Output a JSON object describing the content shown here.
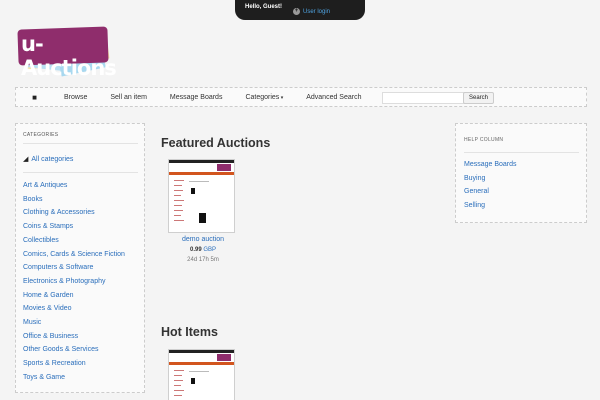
{
  "topbar": {
    "greeting": "Hello, Guest!",
    "login_label": "User login",
    "login_icon": "plus-circle-icon"
  },
  "logo": {
    "text": "u-Auctions",
    "brand_color": "#8f2d6c"
  },
  "nav": {
    "home_icon": "home-icon",
    "items": [
      "Browse",
      "Sell an item",
      "Message Boards",
      "Categories",
      "Advanced Search"
    ],
    "search_value": "",
    "search_button": "Search"
  },
  "categories": {
    "heading": "CATEGORIES",
    "all_label": "All categories",
    "items": [
      "Art & Antiques",
      "Books",
      "Clothing & Accessories",
      "Coins & Stamps",
      "Collectibles",
      "Comics, Cards & Science Fiction",
      "Computers & Software",
      "Electronics & Photography",
      "Home & Garden",
      "Movies & Video",
      "Music",
      "Office & Business",
      "Other Goods & Services",
      "Sports & Recreation",
      "Toys & Game"
    ]
  },
  "featured": {
    "title": "Featured Auctions",
    "card": {
      "title": "demo auction",
      "price": "0.99",
      "currency": "GBP",
      "time_left": "24d 17h 5m"
    }
  },
  "hot": {
    "title": "Hot Items"
  },
  "help": {
    "heading": "HELP COLUMN",
    "items": [
      "Message Boards",
      "Buying",
      "General",
      "Selling"
    ]
  },
  "colors": {
    "link": "#2a6ebb",
    "nav_accent": "#d2551e"
  }
}
